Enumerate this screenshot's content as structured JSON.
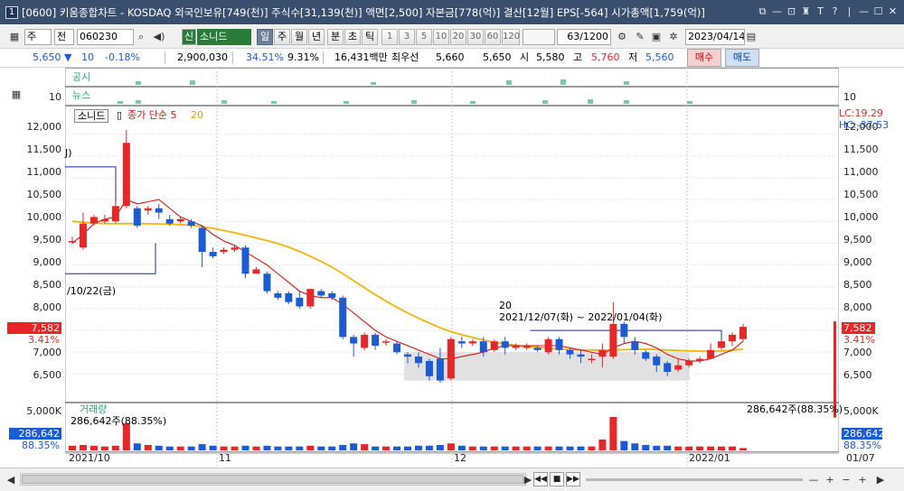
{
  "window": {
    "number": "1",
    "title": "[0600] 키움종합차트 - KOSDAQ 외국인보유[749(천)] 주식수[31,139(천)] 액면[2,500] 자본금[778(억)] 결산[12월] EPS[-564] 시가총액[1,759(억)]",
    "controls": [
      "⧉",
      "—",
      "⊡",
      "♜",
      "T",
      "?",
      "|",
      "—",
      "☐",
      "✕"
    ]
  },
  "toolbar": {
    "market": "주",
    "scope": "전",
    "code": "060230",
    "stock_badge": "신",
    "stock_name": "소니드",
    "periods": [
      "일",
      "주",
      "월",
      "년",
      "분",
      "초",
      "틱"
    ],
    "active_period": "일",
    "intervals": [
      "1",
      "3",
      "5",
      "10",
      "20",
      "30",
      "60",
      "120"
    ],
    "count": "63/1200",
    "date": "2023/04/14"
  },
  "quote": {
    "price": "5,650",
    "change": "10",
    "change_pct": "-0.18%",
    "volume": "2,900,030",
    "turnover_pct": "34.51%",
    "ratio": "9.31%",
    "amount": "16,431백만",
    "best_bid_label": "최우선",
    "best_bid": "5,660",
    "best_ask": "5,650",
    "open_label": "시",
    "open": "5,580",
    "high_label": "고",
    "high": "5,760",
    "low_label": "저",
    "low": "5,560",
    "buy_label": "매수",
    "sell_label": "매도"
  },
  "panels": {
    "disclosure_label": "공시",
    "news_label": "뉴스",
    "panel_scale": "10",
    "legend_name": "소니드",
    "legend_ma": "종가 단순 5",
    "legend_ma2": "20",
    "lc": "LC:19.29",
    "hc": "HC:-37.53",
    "left_tag1": "J)",
    "left_tag2": "/10/22(금)",
    "range_count": "20",
    "range_text": "2021/12/07(화) ~ 2022/01/04(화)",
    "price_tag": "7,582",
    "price_tag_pct": "3.41%",
    "volume_label": "거래량",
    "volume_value_left": "286,642주(88.35%)",
    "volume_value_right": "286,642주(88.35%)",
    "volume_tag": "286,642",
    "volume_tag_pct": "88.35%",
    "volume_scale": "5,000K"
  },
  "axes": {
    "price_ticks": [
      "12,000",
      "11,500",
      "11,000",
      "10,500",
      "10,000",
      "9,500",
      "9,000",
      "8,500",
      "8,000",
      "7,500",
      "7,000",
      "6,500"
    ],
    "date_ticks": [
      "2021/10",
      "11",
      "12",
      "2022/01"
    ],
    "right_date": "01/07"
  },
  "colors": {
    "up": "#e8262a",
    "down": "#1c5bd8",
    "ma5": "#d11",
    "ma20": "#f2b50b"
  },
  "chart_data": {
    "type": "candlestick",
    "dates": [
      "2021/10",
      "11",
      "12",
      "2022/01"
    ],
    "candles": [
      [
        9550,
        9550,
        9480,
        9650
      ],
      [
        9400,
        9950,
        9350,
        10200
      ],
      [
        9950,
        10100,
        9900,
        10150
      ],
      [
        10000,
        10050,
        9950,
        10150
      ],
      [
        10000,
        10350,
        9950,
        10450
      ],
      [
        10350,
        11800,
        10300,
        12100
      ],
      [
        10300,
        9900,
        9850,
        10350
      ],
      [
        10250,
        10300,
        10150,
        10350
      ],
      [
        10300,
        10200,
        10050,
        10400
      ],
      [
        10050,
        9950,
        9900,
        10150
      ],
      [
        10000,
        10050,
        9950,
        10100
      ],
      [
        10000,
        9900,
        9850,
        10050
      ],
      [
        9850,
        9300,
        8950,
        9900
      ],
      [
        9300,
        9200,
        9150,
        9400
      ],
      [
        9300,
        9350,
        9250,
        9400
      ],
      [
        9350,
        9400,
        9300,
        9450
      ],
      [
        9400,
        8800,
        8700,
        9450
      ],
      [
        8800,
        8900,
        8800,
        8950
      ],
      [
        8800,
        8400,
        8350,
        8850
      ],
      [
        8350,
        8250,
        8200,
        8400
      ],
      [
        8350,
        8150,
        8100,
        8400
      ],
      [
        8250,
        8050,
        8000,
        8400
      ],
      [
        8050,
        8450,
        8000,
        8450
      ],
      [
        8400,
        8300,
        8250,
        8450
      ],
      [
        8350,
        8250,
        8200,
        8400
      ],
      [
        8250,
        7350,
        7300,
        8300
      ],
      [
        7350,
        7200,
        6900,
        7400
      ],
      [
        7100,
        7400,
        7050,
        7450
      ],
      [
        7400,
        7150,
        7050,
        7450
      ],
      [
        7250,
        7250,
        7150,
        7300
      ],
      [
        7200,
        7000,
        6950,
        7250
      ],
      [
        6950,
        6900,
        6750,
        7000
      ],
      [
        6900,
        6750,
        6650,
        7000
      ],
      [
        6800,
        6450,
        6350,
        6850
      ],
      [
        6850,
        6350,
        6300,
        7100
      ],
      [
        6400,
        7300,
        6350,
        7350
      ],
      [
        7250,
        7200,
        7100,
        7350
      ],
      [
        7200,
        7250,
        7150,
        7300
      ],
      [
        7250,
        7000,
        6900,
        7350
      ],
      [
        7050,
        7250,
        7000,
        7300
      ],
      [
        7250,
        7100,
        6950,
        7350
      ],
      [
        7100,
        7150,
        7050,
        7200
      ],
      [
        7100,
        7150,
        7050,
        7200
      ],
      [
        7100,
        7050,
        7000,
        7150
      ],
      [
        7000,
        7300,
        6950,
        7350
      ],
      [
        7300,
        7050,
        6950,
        7350
      ],
      [
        7050,
        6950,
        6850,
        7100
      ],
      [
        6950,
        6900,
        6750,
        7050
      ],
      [
        6850,
        6850,
        6750,
        6950
      ],
      [
        6900,
        7050,
        6650,
        7200
      ],
      [
        6900,
        7650,
        6850,
        8150
      ],
      [
        7650,
        7350,
        7200,
        7700
      ],
      [
        7250,
        7050,
        6950,
        7350
      ],
      [
        7000,
        6850,
        6800,
        7050
      ],
      [
        6900,
        6700,
        6550,
        6950
      ],
      [
        6750,
        6550,
        6450,
        6800
      ],
      [
        6600,
        6700,
        6550,
        6850
      ],
      [
        6700,
        6800,
        6650,
        6850
      ],
      [
        6800,
        6850,
        6750,
        6900
      ],
      [
        6850,
        7050,
        6850,
        7200
      ],
      [
        7100,
        7250,
        7050,
        7300
      ],
      [
        7250,
        7400,
        7150,
        7450
      ],
      [
        7300,
        7582,
        7250,
        7650
      ]
    ],
    "ma5": [
      9500,
      9700,
      9950,
      10050,
      10100,
      10500,
      10400,
      10450,
      10500,
      10300,
      10100,
      10000,
      9900,
      9700,
      9550,
      9450,
      9300,
      9150,
      9000,
      8800,
      8600,
      8400,
      8300,
      8250,
      8250,
      8100,
      7900,
      7700,
      7500,
      7350,
      7250,
      7150,
      7050,
      6950,
      6850,
      6850,
      6900,
      6950,
      7000,
      7100,
      7150,
      7150,
      7150,
      7150,
      7150,
      7150,
      7100,
      7050,
      7000,
      6950,
      7100,
      7200,
      7250,
      7200,
      7100,
      6950,
      6850,
      6800,
      6800,
      6850,
      6950,
      7050,
      7250
    ],
    "ma20": [
      10000,
      9980,
      9960,
      9950,
      9945,
      9950,
      9950,
      9945,
      9940,
      9935,
      9925,
      9910,
      9880,
      9840,
      9790,
      9740,
      9680,
      9620,
      9560,
      9490,
      9410,
      9310,
      9200,
      9080,
      8950,
      8800,
      8640,
      8480,
      8320,
      8170,
      8030,
      7900,
      7780,
      7670,
      7560,
      7470,
      7400,
      7340,
      7280,
      7230,
      7190,
      7160,
      7130,
      7110,
      7090,
      7070,
      7060,
      7050,
      7050,
      7045,
      7050,
      7060,
      7065,
      7070,
      7060,
      7050,
      7040,
      7030,
      7025,
      7020,
      7030,
      7050,
      7070
    ],
    "volume": [
      0.6,
      0.7,
      0.6,
      0.5,
      0.6,
      3.5,
      0.9,
      0.7,
      0.6,
      0.5,
      0.5,
      0.5,
      0.8,
      0.6,
      0.5,
      0.5,
      0.6,
      0.5,
      0.6,
      0.5,
      0.5,
      0.5,
      0.6,
      0.5,
      0.5,
      0.7,
      0.9,
      0.8,
      0.5,
      0.5,
      0.5,
      0.5,
      0.6,
      0.6,
      0.7,
      0.9,
      0.6,
      0.5,
      0.5,
      0.5,
      0.5,
      0.5,
      0.5,
      0.5,
      0.5,
      0.5,
      0.5,
      0.5,
      0.5,
      1.4,
      4.3,
      1.2,
      0.9,
      0.7,
      0.6,
      0.6,
      0.5,
      0.5,
      0.5,
      0.5,
      0.5,
      0.5,
      0.3
    ],
    "price_range": [
      6000,
      12500
    ],
    "volume_max": 5000
  }
}
